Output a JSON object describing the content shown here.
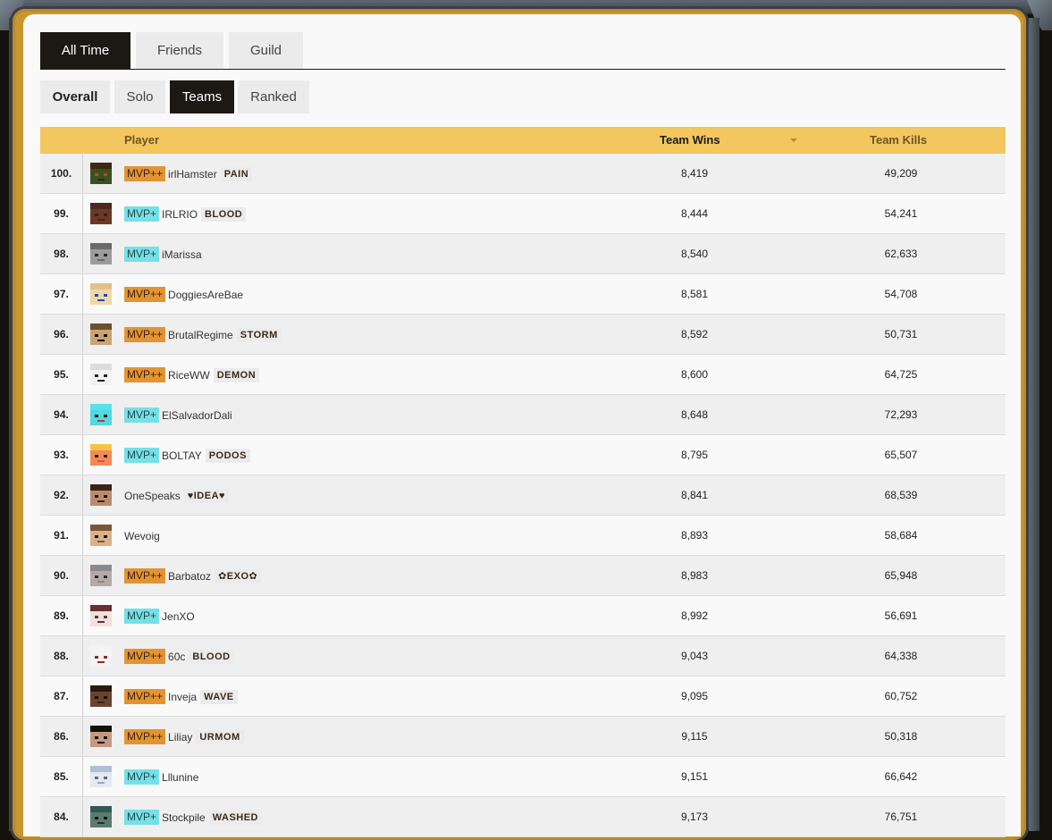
{
  "tabs": [
    {
      "label": "All Time",
      "active": true
    },
    {
      "label": "Friends",
      "active": false
    },
    {
      "label": "Guild",
      "active": false
    }
  ],
  "subtabs": [
    {
      "label": "Overall",
      "active": false
    },
    {
      "label": "Solo",
      "active": false
    },
    {
      "label": "Teams",
      "active": true
    },
    {
      "label": "Ranked",
      "active": false
    }
  ],
  "table": {
    "headers": {
      "player": "Player",
      "wins": "Team Wins",
      "kills": "Team Kills"
    },
    "sort_icon": "sort-desc-icon",
    "rows": [
      {
        "rank": "100.",
        "badge": "MVP++",
        "name": "irlHamster",
        "guild": "PAIN",
        "wins": "8,419",
        "kills": "49,209",
        "skin": {
          "hair": "#3d2a12",
          "face": "#39511f",
          "eye": "#c8402b",
          "mouth": "#2b2b0f"
        }
      },
      {
        "rank": "99.",
        "badge": "MVP+",
        "name": "IRLRIO",
        "guild": "BLOOD",
        "wins": "8,444",
        "kills": "54,241",
        "skin": {
          "hair": "#4a2a1c",
          "face": "#6a3a28",
          "eye": "#3a1e12",
          "mouth": "#4a2418"
        }
      },
      {
        "rank": "98.",
        "badge": "MVP+",
        "name": "iMarissa",
        "guild": "",
        "wins": "8,540",
        "kills": "62,633",
        "skin": {
          "hair": "#6a6a6a",
          "face": "#9c9c9c",
          "eye": "#2a2a2a",
          "mouth": "#6a6a6a"
        }
      },
      {
        "rank": "97.",
        "badge": "MVP++",
        "name": "DoggiesAreBae",
        "guild": "",
        "wins": "8,581",
        "kills": "54,708",
        "skin": {
          "hair": "#e3c08a",
          "face": "#f0d7a8",
          "eye": "#2148b3",
          "mouth": "#2148b3"
        }
      },
      {
        "rank": "96.",
        "badge": "MVP++",
        "name": "BrutalRegime",
        "guild": "STORM",
        "wins": "8,592",
        "kills": "50,731",
        "skin": {
          "hair": "#6b5030",
          "face": "#c9a472",
          "eye": "#111111",
          "mouth": "#111111"
        }
      },
      {
        "rank": "95.",
        "badge": "MVP++",
        "name": "RiceWW",
        "guild": "DEMON",
        "wins": "8,600",
        "kills": "64,725",
        "skin": {
          "hair": "#dcdcdc",
          "face": "#f2f2f2",
          "eye": "#222222",
          "mouth": "#222222"
        }
      },
      {
        "rank": "94.",
        "badge": "MVP+",
        "name": "ElSalvadorDali",
        "guild": "",
        "wins": "8,648",
        "kills": "72,293",
        "skin": {
          "hair": "#56e3e8",
          "face": "#52d8df",
          "eye": "#1a1a1a",
          "mouth": "#c23a2f"
        }
      },
      {
        "rank": "93.",
        "badge": "MVP+",
        "name": "BOLTAY",
        "guild": "PODOS",
        "wins": "8,795",
        "kills": "65,507",
        "skin": {
          "hair": "#f5c542",
          "face": "#f28b56",
          "eye": "#222222",
          "mouth": "#e8484a"
        }
      },
      {
        "rank": "92.",
        "badge": "",
        "name": "OneSpeaks",
        "guild": "♥IDEA♥",
        "wins": "8,841",
        "kills": "68,539",
        "skin": {
          "hair": "#3a2418",
          "face": "#b98b6e",
          "eye": "#1a1a1a",
          "mouth": "#3a2418"
        }
      },
      {
        "rank": "91.",
        "badge": "",
        "name": "Wevoig",
        "guild": "",
        "wins": "8,893",
        "kills": "58,684",
        "skin": {
          "hair": "#7a5638",
          "face": "#d9b08a",
          "eye": "#111111",
          "mouth": "#7a5638"
        }
      },
      {
        "rank": "90.",
        "badge": "MVP++",
        "name": "Barbatoz",
        "guild": "✿EXO✿",
        "wins": "8,983",
        "kills": "65,948",
        "skin": {
          "hair": "#8a8a8a",
          "face": "#b6a9a5",
          "eye": "#2a2a2a",
          "mouth": "#8a8a8a"
        }
      },
      {
        "rank": "89.",
        "badge": "MVP+",
        "name": "JenXO",
        "guild": "",
        "wins": "8,992",
        "kills": "56,691",
        "skin": {
          "hair": "#6b2f2f",
          "face": "#f0e0e0",
          "eye": "#6b2f2f",
          "mouth": "#6b2f2f"
        }
      },
      {
        "rank": "88.",
        "badge": "MVP++",
        "name": "60c",
        "guild": "BLOOD",
        "wins": "9,043",
        "kills": "64,338",
        "skin": {
          "hair": "#f3f3f3",
          "face": "#f3f3f3",
          "eye": "#8b2a2a",
          "mouth": "#8b2a2a"
        }
      },
      {
        "rank": "87.",
        "badge": "MVP++",
        "name": "Inveja",
        "guild": "WAVE",
        "wins": "9,095",
        "kills": "60,752",
        "skin": {
          "hair": "#2a1a10",
          "face": "#6a4330",
          "eye": "#111111",
          "mouth": "#3a2418"
        }
      },
      {
        "rank": "86.",
        "badge": "MVP++",
        "name": "Liliay",
        "guild": "URMOM",
        "wins": "9,115",
        "kills": "50,318",
        "skin": {
          "hair": "#111111",
          "face": "#c49a80",
          "eye": "#111111",
          "mouth": "#111111"
        }
      },
      {
        "rank": "85.",
        "badge": "MVP+",
        "name": "Lllunine",
        "guild": "",
        "wins": "9,151",
        "kills": "66,642",
        "skin": {
          "hair": "#b0bfd8",
          "face": "#e6e8f0",
          "eye": "#5a6b8a",
          "mouth": "#9aa6bd"
        }
      },
      {
        "rank": "84.",
        "badge": "MVP+",
        "name": "Stockpile",
        "guild": "WASHED",
        "wins": "9,173",
        "kills": "76,751",
        "skin": {
          "hair": "#2f5a55",
          "face": "#5b7a70",
          "eye": "#111111",
          "mouth": "#2a2a2a"
        }
      }
    ]
  }
}
